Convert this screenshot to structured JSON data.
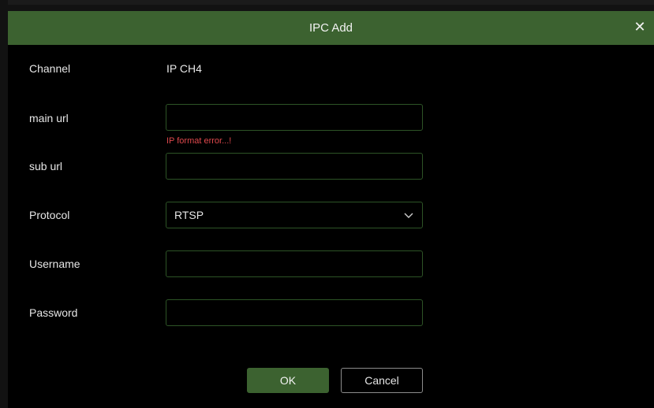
{
  "dialog": {
    "title": "IPC Add",
    "close_glyph": "✕",
    "close_icon": "close-icon"
  },
  "form": {
    "channel_label": "Channel",
    "channel_value": "IP CH4",
    "main_url_label": "main url",
    "main_url_value": "",
    "main_url_error": "IP format error...!",
    "sub_url_label": "sub url",
    "sub_url_value": "",
    "protocol_label": "Protocol",
    "protocol_value": "RTSP",
    "protocol_icon": "chevron-down-icon",
    "username_label": "Username",
    "username_value": "",
    "password_label": "Password",
    "password_value": ""
  },
  "buttons": {
    "ok_label": "OK",
    "cancel_label": "Cancel"
  },
  "colors": {
    "accent": "#3c6230",
    "field_border": "#2d5426",
    "error": "#e0494d",
    "background": "#000000"
  }
}
